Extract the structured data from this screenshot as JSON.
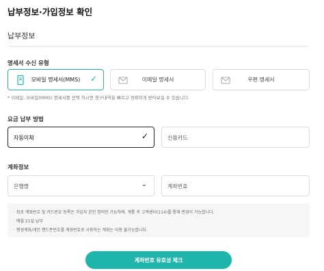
{
  "page": {
    "title": "납부정보·가입정보 확인",
    "section_title": "납부정보"
  },
  "bill_type": {
    "label": "명세서 수신 유형",
    "options": [
      {
        "label": "모바일 명세서(MMS)",
        "icon": "mobile-doc-icon",
        "selected": true
      },
      {
        "label": "이메일 명세서",
        "icon": "email-icon",
        "selected": false
      },
      {
        "label": "우편 명세서",
        "icon": "mail-icon",
        "selected": false
      }
    ],
    "note": "* 이메일, 모바일(MMS) 명세서를 선택 하시면 청구내역을 빠르고 정확하게 받아보실 수 있습니다."
  },
  "payment_method": {
    "label": "요금 납부 방법",
    "options": [
      {
        "label": "자동이체",
        "selected": true
      },
      {
        "label": "신용카드",
        "selected": false
      }
    ]
  },
  "account": {
    "label": "계좌정보",
    "bank_placeholder": "은행명",
    "account_placeholder": "계좌번호"
  },
  "info": {
    "items": [
      "최초 계좌번호 및 카드번호 등록은 가입자 본인 명의만 가능하며, 계통 후 고객센터(114)를 통해 변경이 가능합니다.",
      "매월 21일 납부",
      "평생계좌/개인 핸드폰번호를 계좌번호로 사용하는 계좌는 이용 불가능합니다."
    ]
  },
  "cta": {
    "label": "계좌번호 유효성 체크"
  },
  "colors": {
    "accent": "#1fb5ac",
    "selected_border": "#222222"
  }
}
